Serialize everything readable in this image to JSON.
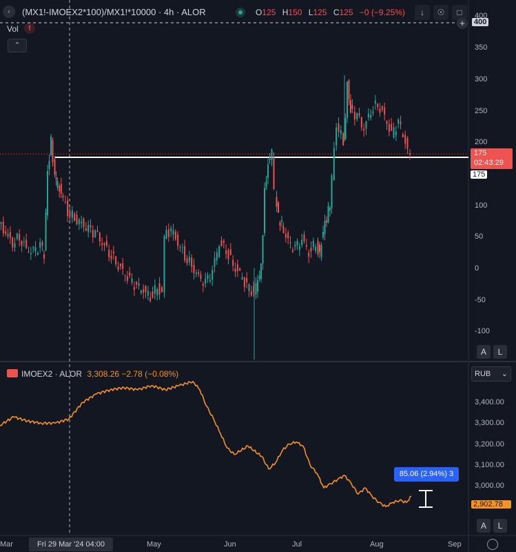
{
  "toolbar": {
    "collapse_icon": "chevron-left-icon",
    "symbol": "(MX1!-IMOEX2*100)/MX1!*10000 · 4h · ALOR",
    "ohlc": {
      "o_label": "O",
      "o": "125",
      "h_label": "H",
      "h": "150",
      "l_label": "L",
      "l": "125",
      "c_label": "C",
      "c": "125",
      "change": "−0 (−9.25%)"
    },
    "icons": [
      "arrow-down-icon",
      "eye-off-icon",
      "camera-icon"
    ]
  },
  "volume": {
    "label": "Vol",
    "warning": "!"
  },
  "main_axis": {
    "ticks": [
      "400",
      "350",
      "300",
      "250",
      "200",
      "150",
      "100",
      "50",
      "0",
      "-50",
      "-100"
    ],
    "highlight_top": "400",
    "price_tag": "175",
    "countdown": "02:43:29",
    "line_tag": "175",
    "auto_button": "A",
    "log_button": "L"
  },
  "index_pane": {
    "name": "IMOEX2 · ALOR",
    "value": "3,308.26 −2.78 (−0.08%)",
    "currency": "RUB",
    "ticks": [
      "3,400.00",
      "3,300.00",
      "3,200.00",
      "3,100.00",
      "3,000.00"
    ],
    "price_tag": "2,902.78",
    "measure_tooltip": "85.06 (2.94%) 3",
    "auto_button": "A",
    "log_button": "L"
  },
  "time_axis": {
    "labels": [
      "Mar",
      "May",
      "Jun",
      "Jul",
      "Aug",
      "Sep"
    ],
    "crosshair_date": "Fri 29 Mar '24   04:00",
    "settings_icon": "gear-icon"
  },
  "colors": {
    "bg": "#131722",
    "up": "#26a69a",
    "down": "#ef5350",
    "index_line": "#f7931e",
    "tag": "#f7931e",
    "blue": "#2962ff"
  },
  "chart_data": [
    {
      "type": "line",
      "title": "(MX1!-IMOEX2*100)/MX1!*10000",
      "xlabel": "",
      "ylabel": "",
      "ylim": [
        -145,
        405
      ],
      "x": [
        0,
        10,
        20,
        30,
        40,
        50,
        60,
        65,
        70,
        75,
        78,
        80,
        82,
        90,
        100,
        110,
        120,
        130,
        140,
        150,
        160,
        170,
        180,
        190,
        200,
        210,
        220,
        230,
        237,
        240,
        250,
        260,
        270,
        280,
        290,
        300,
        310,
        320,
        330,
        340,
        350,
        360,
        370,
        375,
        380,
        385,
        390,
        393,
        396,
        400,
        405,
        410,
        420,
        430,
        440,
        450,
        460,
        465,
        470,
        475,
        480,
        490,
        500,
        505,
        510,
        520,
        530,
        540,
        550,
        560,
        570,
        580,
        590,
        597
      ],
      "values": [
        70,
        55,
        40,
        50,
        30,
        25,
        35,
        20,
        150,
        200,
        175,
        150,
        135,
        120,
        90,
        80,
        70,
        60,
        55,
        40,
        25,
        10,
        -5,
        -20,
        -30,
        -35,
        -45,
        -30,
        -40,
        50,
        60,
        40,
        20,
        5,
        -15,
        -25,
        -5,
        40,
        30,
        5,
        -10,
        -30,
        -40,
        -20,
        0,
        120,
        165,
        170,
        180,
        120,
        80,
        70,
        40,
        30,
        45,
        25,
        40,
        20,
        60,
        80,
        100,
        230,
        200,
        290,
        250,
        240,
        220,
        250,
        260,
        240,
        210,
        230,
        200,
        175
      ],
      "min_spike": {
        "x": 369,
        "value": -145
      },
      "max_spike": {
        "x": 500,
        "value": 305
      }
    },
    {
      "type": "line",
      "title": "IMOEX2 · ALOR",
      "xlabel": "",
      "ylabel": "",
      "ylim": [
        2880,
        3520
      ],
      "x": [
        0,
        20,
        40,
        60,
        80,
        100,
        120,
        140,
        160,
        180,
        200,
        220,
        240,
        260,
        280,
        290,
        300,
        310,
        320,
        330,
        340,
        360,
        380,
        390,
        400,
        410,
        420,
        430,
        440,
        450,
        460,
        470,
        480,
        490,
        500,
        510,
        520,
        530,
        540,
        550,
        560,
        570,
        580,
        590,
        597
      ],
      "values": [
        3290,
        3330,
        3310,
        3300,
        3300,
        3320,
        3400,
        3440,
        3460,
        3470,
        3460,
        3480,
        3460,
        3480,
        3500,
        3460,
        3380,
        3320,
        3250,
        3180,
        3150,
        3190,
        3140,
        3080,
        3110,
        3170,
        3200,
        3210,
        3190,
        3100,
        3060,
        2990,
        3010,
        3030,
        3050,
        3010,
        2960,
        2990,
        2950,
        2920,
        2900,
        2920,
        2930,
        2920,
        2950
      ]
    }
  ]
}
